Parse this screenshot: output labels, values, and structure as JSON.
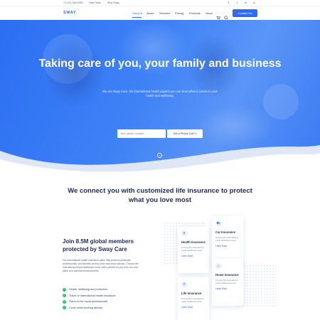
{
  "topbar": {
    "phone": "+1 (12) 345 6789",
    "links": [
      "Help Desk",
      "Why Sway"
    ],
    "social_icons": [
      "facebook-icon",
      "twitter-icon",
      "linkedin-icon",
      "instagram-icon"
    ]
  },
  "header": {
    "logo": "SWAY",
    "nav": [
      "Home",
      "About",
      "Services",
      "Pricing",
      "Products",
      "News"
    ],
    "contact_label": "Contact Us",
    "cart_count": "0"
  },
  "hero": {
    "title": "Taking care of you, your family and business",
    "subtitle": "We are Sway Care, the international health experts you can trust when it comes to your health and wellbeing.",
    "phone_placeholder": "Your phone number...",
    "cta_label": "Get a Phone Call"
  },
  "connect": {
    "title": "We connect you with customized life insurance to protect what you love most"
  },
  "join": {
    "title": "Join 8.5M global members protected by Sway Care",
    "description": "Our international health insurance plans help protect individuals, professionals, and families as they work and travel abroad. Choose the international expat healthcare cover that's perfect for you from our core plans and optional enhancements.",
    "checklist": [
      "Health, wellbeing and protection",
      "Travel or international health insurance",
      "Plans for for expat professionals",
      "Cover while working abroad"
    ]
  },
  "cards": [
    {
      "title": "Health Insurance",
      "desc": "Choose the international expat healthcare cover",
      "link": "Learn More"
    },
    {
      "title": "Car Insurance",
      "desc": "Choose the international expat healthcare cover",
      "link": "Learn More"
    },
    {
      "title": "Life Insurance",
      "desc": "Choose the international expat healthcare cover",
      "link": "Learn More"
    },
    {
      "title": "Home Insurance",
      "desc": "Choose the international expat healthcare cover",
      "link": "Learn More"
    }
  ],
  "colors": {
    "accent": "#2a6af2",
    "heading": "#1f2a5c",
    "check": "#2dbd6e",
    "hero_gradient_start": "#2c6ef2"
  }
}
